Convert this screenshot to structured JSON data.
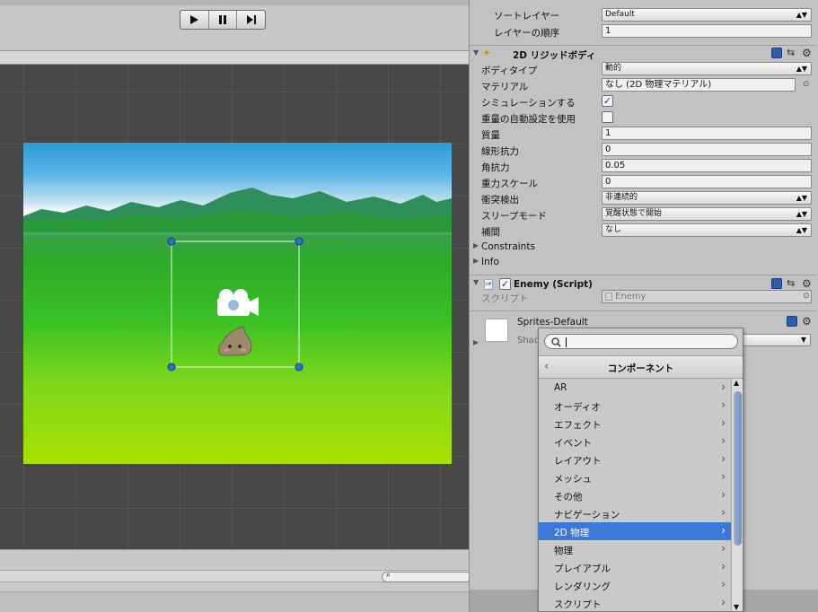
{
  "playbar": {
    "play_icon": "play-icon",
    "pause_icon": "pause-icon",
    "step_icon": "step-icon"
  },
  "inspector": {
    "top_rows": [
      {
        "label": "ソートレイヤー",
        "value": "Default"
      },
      {
        "label": "レイヤーの順序",
        "value": "1"
      }
    ],
    "rigidbody": {
      "title": "2D リジッドボディ",
      "rows": [
        {
          "label": "ボディタイプ",
          "value": "動的",
          "kind": "dropdown"
        },
        {
          "label": "マテリアル",
          "value": "なし (2D 物理マテリアル)",
          "kind": "field"
        },
        {
          "label": "シミュレーションする",
          "value": "✓",
          "kind": "checkbox"
        },
        {
          "label": "重量の自動設定を使用",
          "value": "",
          "kind": "checkbox"
        },
        {
          "label": "質量",
          "value": "1",
          "kind": "field"
        },
        {
          "label": "線形抗力",
          "value": "0",
          "kind": "field"
        },
        {
          "label": "角抗力",
          "value": "0.05",
          "kind": "field"
        },
        {
          "label": "重力スケール",
          "value": "0",
          "kind": "field"
        },
        {
          "label": "衝突検出",
          "value": "非連続的",
          "kind": "dropdown"
        },
        {
          "label": "スリープモード",
          "value": "覚醒状態で開始",
          "kind": "dropdown"
        },
        {
          "label": "補間",
          "value": "なし",
          "kind": "dropdown"
        }
      ],
      "foldouts": [
        "Constraints",
        "Info"
      ]
    },
    "script_component": {
      "title": "Enemy (Script)",
      "script_label": "スクリプト",
      "script_value": "Enemy"
    },
    "material": {
      "name": "Sprites-Default",
      "shader_label": "Shad"
    }
  },
  "popup": {
    "title": "コンポーネント",
    "search_value": "",
    "items": [
      "AR",
      "オーディオ",
      "エフェクト",
      "イベント",
      "レイアウト",
      "メッシュ",
      "その他",
      "ナビゲーション",
      "2D 物理",
      "物理",
      "プレイアブル",
      "レンダリング",
      "スクリプト"
    ],
    "selected_index": 8
  },
  "colors": {
    "selection": "#3b78d8",
    "grass": "#38c024",
    "sky": "#5cb5e6"
  }
}
